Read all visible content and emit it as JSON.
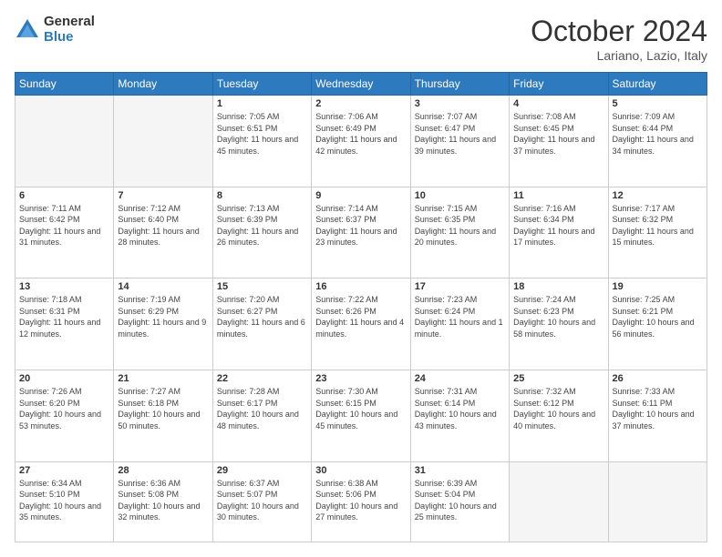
{
  "logo": {
    "general": "General",
    "blue": "Blue"
  },
  "title": {
    "month": "October 2024",
    "location": "Lariano, Lazio, Italy"
  },
  "weekdays": [
    "Sunday",
    "Monday",
    "Tuesday",
    "Wednesday",
    "Thursday",
    "Friday",
    "Saturday"
  ],
  "weeks": [
    [
      {
        "day": "",
        "info": ""
      },
      {
        "day": "",
        "info": ""
      },
      {
        "day": "1",
        "info": "Sunrise: 7:05 AM\nSunset: 6:51 PM\nDaylight: 11 hours and 45 minutes."
      },
      {
        "day": "2",
        "info": "Sunrise: 7:06 AM\nSunset: 6:49 PM\nDaylight: 11 hours and 42 minutes."
      },
      {
        "day": "3",
        "info": "Sunrise: 7:07 AM\nSunset: 6:47 PM\nDaylight: 11 hours and 39 minutes."
      },
      {
        "day": "4",
        "info": "Sunrise: 7:08 AM\nSunset: 6:45 PM\nDaylight: 11 hours and 37 minutes."
      },
      {
        "day": "5",
        "info": "Sunrise: 7:09 AM\nSunset: 6:44 PM\nDaylight: 11 hours and 34 minutes."
      }
    ],
    [
      {
        "day": "6",
        "info": "Sunrise: 7:11 AM\nSunset: 6:42 PM\nDaylight: 11 hours and 31 minutes."
      },
      {
        "day": "7",
        "info": "Sunrise: 7:12 AM\nSunset: 6:40 PM\nDaylight: 11 hours and 28 minutes."
      },
      {
        "day": "8",
        "info": "Sunrise: 7:13 AM\nSunset: 6:39 PM\nDaylight: 11 hours and 26 minutes."
      },
      {
        "day": "9",
        "info": "Sunrise: 7:14 AM\nSunset: 6:37 PM\nDaylight: 11 hours and 23 minutes."
      },
      {
        "day": "10",
        "info": "Sunrise: 7:15 AM\nSunset: 6:35 PM\nDaylight: 11 hours and 20 minutes."
      },
      {
        "day": "11",
        "info": "Sunrise: 7:16 AM\nSunset: 6:34 PM\nDaylight: 11 hours and 17 minutes."
      },
      {
        "day": "12",
        "info": "Sunrise: 7:17 AM\nSunset: 6:32 PM\nDaylight: 11 hours and 15 minutes."
      }
    ],
    [
      {
        "day": "13",
        "info": "Sunrise: 7:18 AM\nSunset: 6:31 PM\nDaylight: 11 hours and 12 minutes."
      },
      {
        "day": "14",
        "info": "Sunrise: 7:19 AM\nSunset: 6:29 PM\nDaylight: 11 hours and 9 minutes."
      },
      {
        "day": "15",
        "info": "Sunrise: 7:20 AM\nSunset: 6:27 PM\nDaylight: 11 hours and 6 minutes."
      },
      {
        "day": "16",
        "info": "Sunrise: 7:22 AM\nSunset: 6:26 PM\nDaylight: 11 hours and 4 minutes."
      },
      {
        "day": "17",
        "info": "Sunrise: 7:23 AM\nSunset: 6:24 PM\nDaylight: 11 hours and 1 minute."
      },
      {
        "day": "18",
        "info": "Sunrise: 7:24 AM\nSunset: 6:23 PM\nDaylight: 10 hours and 58 minutes."
      },
      {
        "day": "19",
        "info": "Sunrise: 7:25 AM\nSunset: 6:21 PM\nDaylight: 10 hours and 56 minutes."
      }
    ],
    [
      {
        "day": "20",
        "info": "Sunrise: 7:26 AM\nSunset: 6:20 PM\nDaylight: 10 hours and 53 minutes."
      },
      {
        "day": "21",
        "info": "Sunrise: 7:27 AM\nSunset: 6:18 PM\nDaylight: 10 hours and 50 minutes."
      },
      {
        "day": "22",
        "info": "Sunrise: 7:28 AM\nSunset: 6:17 PM\nDaylight: 10 hours and 48 minutes."
      },
      {
        "day": "23",
        "info": "Sunrise: 7:30 AM\nSunset: 6:15 PM\nDaylight: 10 hours and 45 minutes."
      },
      {
        "day": "24",
        "info": "Sunrise: 7:31 AM\nSunset: 6:14 PM\nDaylight: 10 hours and 43 minutes."
      },
      {
        "day": "25",
        "info": "Sunrise: 7:32 AM\nSunset: 6:12 PM\nDaylight: 10 hours and 40 minutes."
      },
      {
        "day": "26",
        "info": "Sunrise: 7:33 AM\nSunset: 6:11 PM\nDaylight: 10 hours and 37 minutes."
      }
    ],
    [
      {
        "day": "27",
        "info": "Sunrise: 6:34 AM\nSunset: 5:10 PM\nDaylight: 10 hours and 35 minutes."
      },
      {
        "day": "28",
        "info": "Sunrise: 6:36 AM\nSunset: 5:08 PM\nDaylight: 10 hours and 32 minutes."
      },
      {
        "day": "29",
        "info": "Sunrise: 6:37 AM\nSunset: 5:07 PM\nDaylight: 10 hours and 30 minutes."
      },
      {
        "day": "30",
        "info": "Sunrise: 6:38 AM\nSunset: 5:06 PM\nDaylight: 10 hours and 27 minutes."
      },
      {
        "day": "31",
        "info": "Sunrise: 6:39 AM\nSunset: 5:04 PM\nDaylight: 10 hours and 25 minutes."
      },
      {
        "day": "",
        "info": ""
      },
      {
        "day": "",
        "info": ""
      }
    ]
  ]
}
